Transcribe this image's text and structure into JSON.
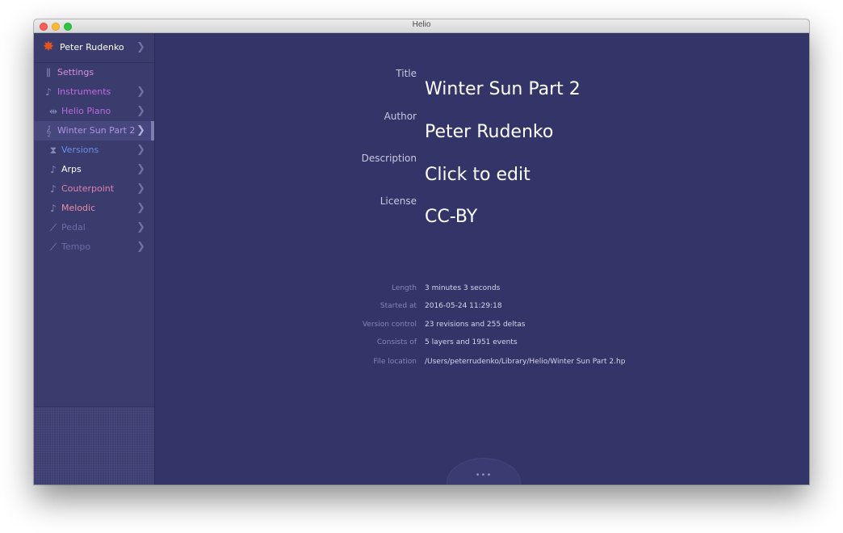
{
  "window": {
    "title": "Helio"
  },
  "sidebar": {
    "user": {
      "name": "Peter Rudenko",
      "icon": "star-icon",
      "icon_color": "#e8541e"
    },
    "items": [
      {
        "label": "Settings",
        "icon": "sliders-icon",
        "color": "#d98fe0"
      },
      {
        "label": "Instruments",
        "icon": "saxophone-icon",
        "color": "#c56bdc"
      },
      {
        "label": "Helio Piano",
        "icon": "piano-icon",
        "color": "#b96bdc"
      },
      {
        "label": "Winter Sun Part 2",
        "icon": "treble-clef-icon",
        "color": "#b094e0",
        "selected": true
      },
      {
        "label": "Versions",
        "icon": "hourglass-icon",
        "color": "#6c8ee8"
      },
      {
        "label": "Arps",
        "icon": "note-icon",
        "color": "#ffffff"
      },
      {
        "label": "Couterpoint",
        "icon": "note-icon",
        "color": "#e082b0"
      },
      {
        "label": "Melodic",
        "icon": "note-icon",
        "color": "#e88fa0"
      },
      {
        "label": "Pedal",
        "icon": "automation-icon",
        "color": "#6b6ea8"
      },
      {
        "label": "Tempo",
        "icon": "automation-icon",
        "color": "#6b6ea8"
      }
    ]
  },
  "project": {
    "title_label": "Title",
    "title_value": "Winter Sun Part 2",
    "author_label": "Author",
    "author_value": "Peter Rudenko",
    "description_label": "Description",
    "description_value": "Click to edit",
    "license_label": "License",
    "license_value": "CC-BY"
  },
  "info": {
    "length_label": "Length",
    "length_value": "3 minutes 3 seconds",
    "started_label": "Started at",
    "started_value": "2016-05-24 11:29:18",
    "version_label": "Version control",
    "version_value": "23 revisions and 255 deltas",
    "consists_label": "Consists of",
    "consists_value": "5 layers and 1951 events",
    "location_label": "File location",
    "location_value": "/Users/peterrudenko/Library/Helio/Winter Sun Part 2.hp"
  },
  "more_button": {
    "label": "•••"
  }
}
